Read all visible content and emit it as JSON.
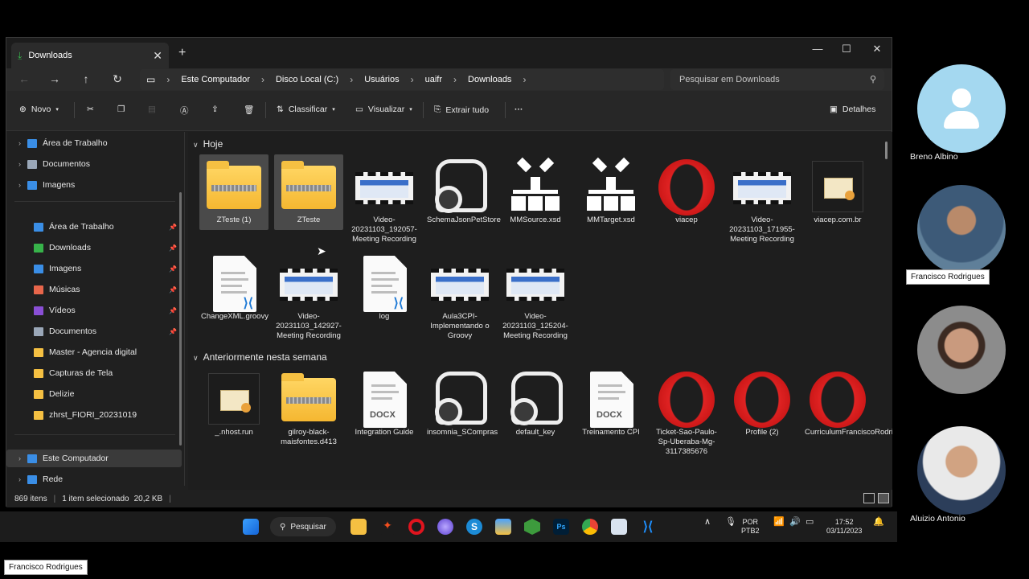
{
  "window": {
    "tab_title": "Downloads",
    "breadcrumb": [
      "Este Computador",
      "Disco Local (C:)",
      "Usuários",
      "uaifr",
      "Downloads"
    ],
    "search_placeholder": "Pesquisar em Downloads"
  },
  "toolbar": {
    "new_label": "Novo",
    "sort_label": "Classificar",
    "view_label": "Visualizar",
    "extract_label": "Extrair tudo",
    "details_label": "Detalhes",
    "more_label": "···"
  },
  "sidebar": {
    "items": [
      {
        "label": "Área de Trabalho",
        "icon": "desktop-icon",
        "color": "#3a8ee6"
      },
      {
        "label": "Documentos",
        "icon": "documents-icon",
        "color": "#9aa7b8"
      },
      {
        "label": "Imagens",
        "icon": "images-icon",
        "color": "#3a8ee6"
      },
      {
        "label": "Área de Trabalho",
        "icon": "desktop-icon",
        "color": "#3a8ee6",
        "pinned": true
      },
      {
        "label": "Downloads",
        "icon": "download-icon",
        "color": "#37b34a",
        "pinned": true
      },
      {
        "label": "Imagens",
        "icon": "images-icon",
        "color": "#3a8ee6",
        "pinned": true
      },
      {
        "label": "Músicas",
        "icon": "music-icon",
        "color": "#e8664b",
        "pinned": true
      },
      {
        "label": "Vídeos",
        "icon": "videos-icon",
        "color": "#8a4fd6",
        "pinned": true
      },
      {
        "label": "Documentos",
        "icon": "documents-icon",
        "color": "#9aa7b8",
        "pinned": true
      },
      {
        "label": "Master - Agencia digital",
        "icon": "folder-icon",
        "color": "#f5c042"
      },
      {
        "label": "Capturas de Tela",
        "icon": "folder-icon",
        "color": "#f5c042"
      },
      {
        "label": "Delizie",
        "icon": "folder-icon",
        "color": "#f5c042"
      },
      {
        "label": "zhrst_FIORI_20231019",
        "icon": "folder-icon",
        "color": "#f5c042"
      },
      {
        "label": "Este Computador",
        "icon": "computer-icon",
        "color": "#3a8ee6"
      },
      {
        "label": "Rede",
        "icon": "network-icon",
        "color": "#3a8ee6"
      }
    ]
  },
  "groups": {
    "today": "Hoje",
    "earlier": "Anteriormente nesta semana"
  },
  "files_today": [
    {
      "name": "ZTeste (1)",
      "type": "zip"
    },
    {
      "name": "ZTeste",
      "type": "zip"
    },
    {
      "name": "Video-20231103_192057-Meeting Recording",
      "type": "video"
    },
    {
      "name": "SchemaJsonPetStore",
      "type": "json"
    },
    {
      "name": "MMSource.xsd",
      "type": "xsd"
    },
    {
      "name": "MMTarget.xsd",
      "type": "xsd"
    },
    {
      "name": "viacep",
      "type": "opera"
    },
    {
      "name": "Video-20231103_171955-Meeting Recording",
      "type": "video"
    },
    {
      "name": "viacep.com.br",
      "type": "cert"
    },
    {
      "name": "ChangeXML.groovy",
      "type": "code"
    },
    {
      "name": "Video-20231103_142927-Meeting Recording",
      "type": "video"
    },
    {
      "name": "log",
      "type": "code"
    },
    {
      "name": "Aula3CPI-Implementando o Groovy",
      "type": "video"
    },
    {
      "name": "Video-20231103_125204-Meeting Recording",
      "type": "video"
    }
  ],
  "files_earlier": [
    {
      "name": "_.nhost.run",
      "type": "cert"
    },
    {
      "name": "gilroy-black-maisfontes.d413",
      "type": "zip"
    },
    {
      "name": "Integration Guide",
      "type": "docx"
    },
    {
      "name": "insomnia_SCompras",
      "type": "json"
    },
    {
      "name": "default_key",
      "type": "json"
    },
    {
      "name": "Treinamento CPI",
      "type": "docx"
    },
    {
      "name": "Ticket-Sao-Paulo-Sp-Uberaba-Mg-3117385676",
      "type": "opera"
    },
    {
      "name": "Profile (2)",
      "type": "opera"
    },
    {
      "name": "CurriculumFranciscoRodriguesFrances.pdf",
      "type": "opera"
    }
  ],
  "docx_tag": "DOCX",
  "status": {
    "items": "869 itens",
    "selection": "1 item selecionado",
    "size": "20,2 KB"
  },
  "taskbar": {
    "search_label": "Pesquisar",
    "lang": "POR",
    "layout": "PTB2",
    "time": "17:52",
    "date": "03/11/2023"
  },
  "participants": [
    {
      "name": "Breno Albino"
    },
    {
      "name": "Francisco Rodrigues"
    },
    {
      "name": "Aluizio Antonio"
    }
  ],
  "presenter_label": "Francisco Rodrigues",
  "colors": {
    "accent": "#3a8ee6",
    "window_bg": "#202020",
    "folder": "#f5c042",
    "opera": "#e0141e"
  }
}
